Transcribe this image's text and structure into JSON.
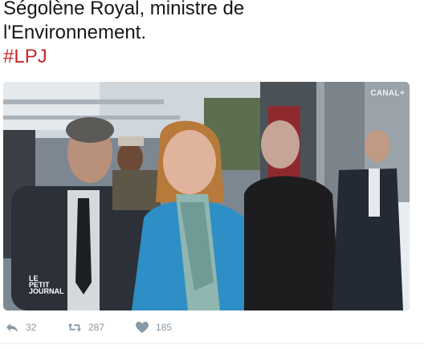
{
  "tweet": {
    "text_line1": "Ségolène Royal, ministre de",
    "text_line2": "l'Environnement.",
    "hashtag": "#LPJ"
  },
  "media": {
    "channel_badge": "CANAL+",
    "show_logo": [
      "LE",
      "PETIT",
      "JOURNAL"
    ]
  },
  "actions": {
    "reply_count": "32",
    "retweet_count": "287",
    "like_count": "185"
  },
  "colors": {
    "hashtag": "#c8282d",
    "action_gray": "#8899a6"
  }
}
